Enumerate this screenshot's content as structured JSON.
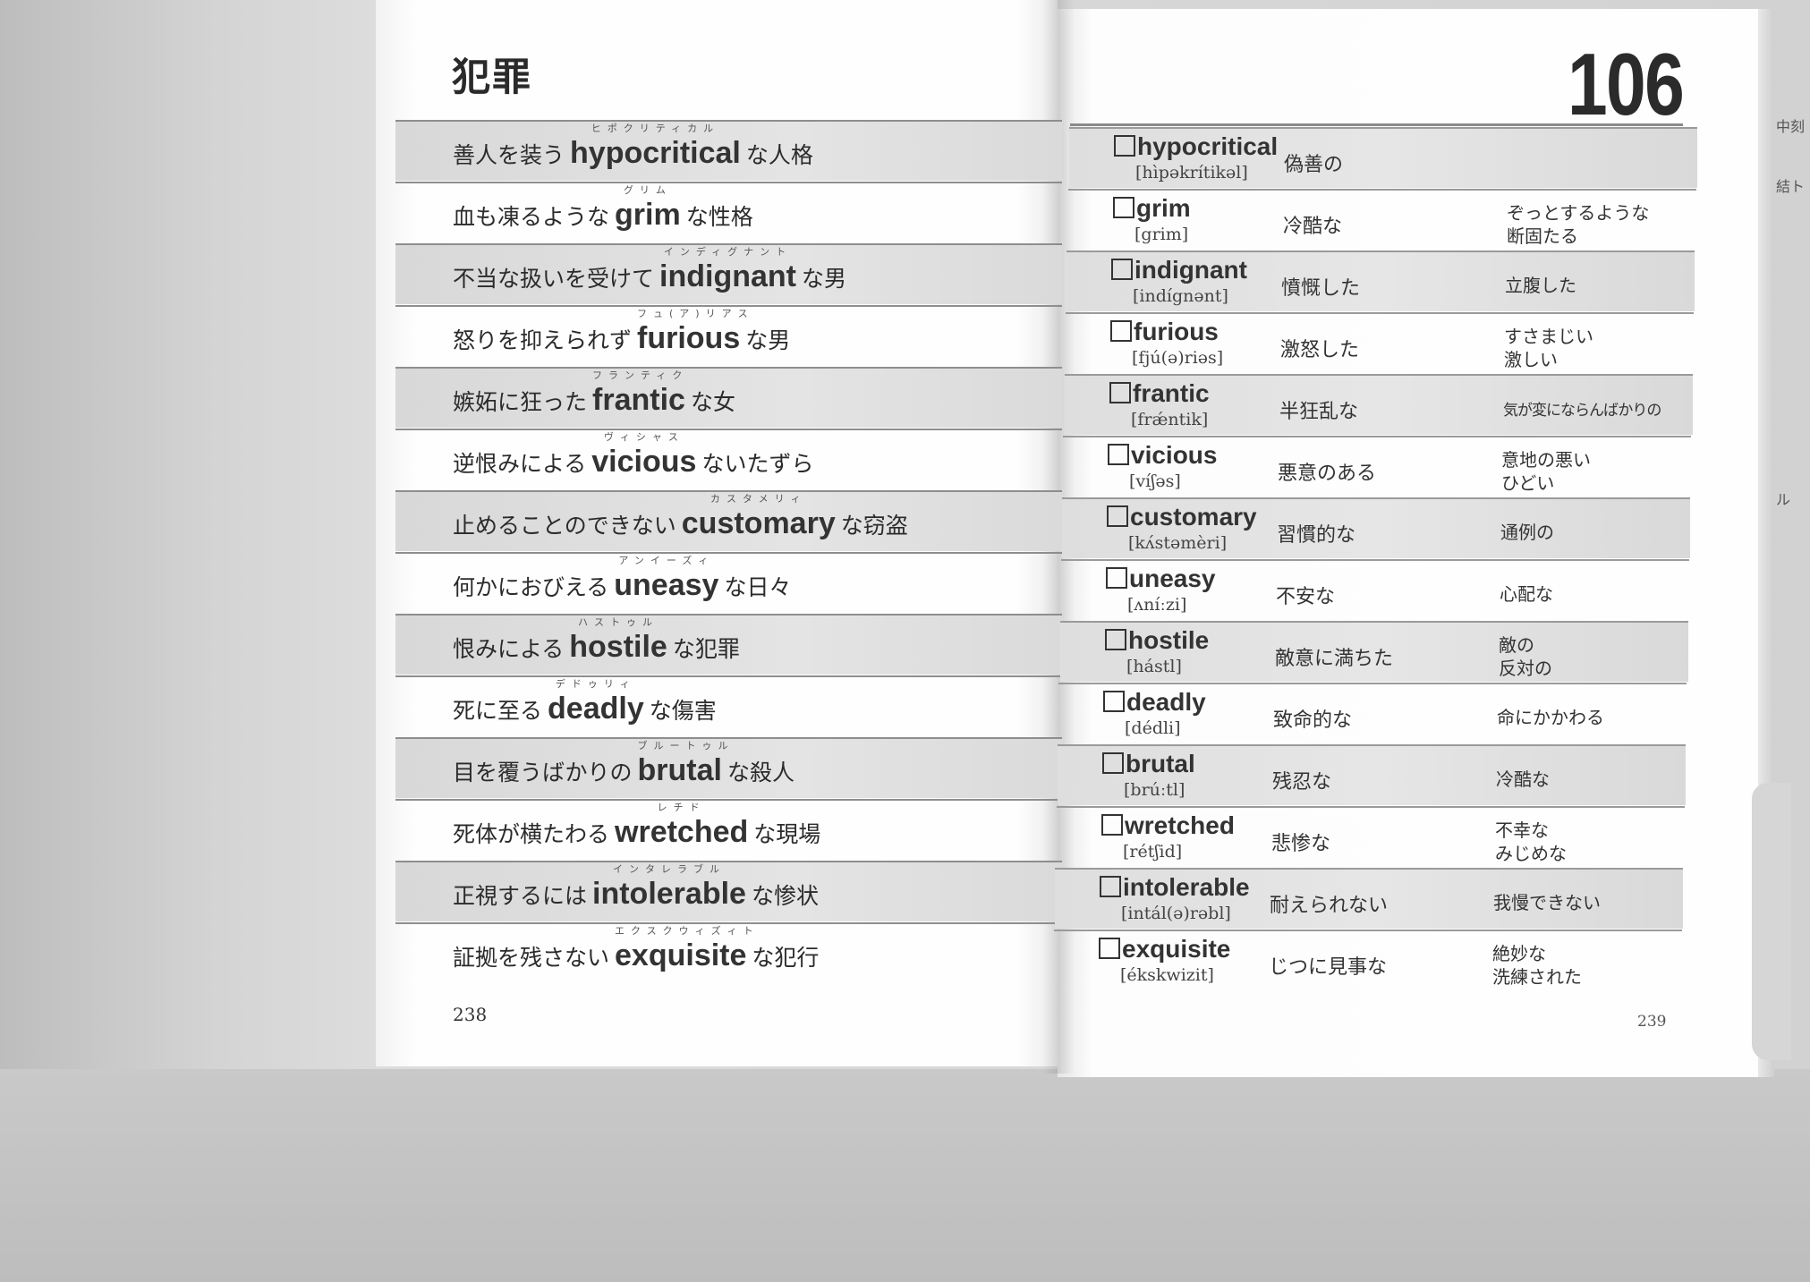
{
  "left_page": {
    "section_title": "犯罪",
    "page_number": "238",
    "phrases": [
      {
        "before": "善人を装う",
        "word": "hypocritical",
        "ruby": "ヒポクリティカル",
        "after": "な人格"
      },
      {
        "before": "血も凍るような",
        "word": "grim",
        "ruby": "グリム",
        "after": "な性格"
      },
      {
        "before": "不当な扱いを受けて",
        "word": "indignant",
        "ruby": "インディグナント",
        "after": "な男"
      },
      {
        "before": "怒りを抑えられず",
        "word": "furious",
        "ruby": "フュ(ア)リアス",
        "after": "な男"
      },
      {
        "before": "嫉妬に狂った",
        "word": "frantic",
        "ruby": "フランティク",
        "after": "な女"
      },
      {
        "before": "逆恨みによる",
        "word": "vicious",
        "ruby": "ヴィシャス",
        "after": "ないたずら"
      },
      {
        "before": "止めることのできない",
        "word": "customary",
        "ruby": "カスタメリィ",
        "after": "な窃盗"
      },
      {
        "before": "何かにおびえる",
        "word": "uneasy",
        "ruby": "アンイーズィ",
        "after": "な日々"
      },
      {
        "before": "恨みによる",
        "word": "hostile",
        "ruby": "ハストゥル",
        "after": "な犯罪"
      },
      {
        "before": "死に至る",
        "word": "deadly",
        "ruby": "デドゥリィ",
        "after": "な傷害"
      },
      {
        "before": "目を覆うばかりの",
        "word": "brutal",
        "ruby": "ブルートゥル",
        "after": "な殺人"
      },
      {
        "before": "死体が横たわる",
        "word": "wretched",
        "ruby": "レチド",
        "after": "な現場"
      },
      {
        "before": "正視するには",
        "word": "intolerable",
        "ruby": "インタレラブル",
        "after": "な惨状"
      },
      {
        "before": "証拠を残さない",
        "word": "exquisite",
        "ruby": "エクスクウィズィト",
        "after": "な犯行"
      }
    ]
  },
  "right_page": {
    "lesson_number": "106",
    "page_number": "239",
    "vocab": [
      {
        "word": "hypocritical",
        "ipa": "[hìpəkrítikəl]",
        "meaning1": "偽善の",
        "meaning2": ""
      },
      {
        "word": "grim",
        "ipa": "[grim]",
        "meaning1": "冷酷な",
        "meaning2": "ぞっとするような 断固たる"
      },
      {
        "word": "indignant",
        "ipa": "[indígnənt]",
        "meaning1": "憤慨した",
        "meaning2": "立腹した"
      },
      {
        "word": "furious",
        "ipa": "[fjú(ə)riəs]",
        "meaning1": "激怒した",
        "meaning2": "すさまじい 激しい"
      },
      {
        "word": "frantic",
        "ipa": "[frǽntik]",
        "meaning1": "半狂乱な",
        "meaning2": "気が変にならんばかりの"
      },
      {
        "word": "vicious",
        "ipa": "[víʃəs]",
        "meaning1": "悪意のある",
        "meaning2": "意地の悪い ひどい"
      },
      {
        "word": "customary",
        "ipa": "[kʌ́stəmèri]",
        "meaning1": "習慣的な",
        "meaning2": "通例の"
      },
      {
        "word": "uneasy",
        "ipa": "[ʌníːzi]",
        "meaning1": "不安な",
        "meaning2": "心配な"
      },
      {
        "word": "hostile",
        "ipa": "[hástl]",
        "meaning1": "敵意に満ちた",
        "meaning2": "敵の 反対の"
      },
      {
        "word": "deadly",
        "ipa": "[dédli]",
        "meaning1": "致命的な",
        "meaning2": "命にかかわる"
      },
      {
        "word": "brutal",
        "ipa": "[brúːtl]",
        "meaning1": "残忍な",
        "meaning2": "冷酷な"
      },
      {
        "word": "wretched",
        "ipa": "[rétʃid]",
        "meaning1": "悲惨な",
        "meaning2": "不幸な みじめな"
      },
      {
        "word": "intolerable",
        "ipa": "[intál(ə)rəbl]",
        "meaning1": "耐えられない",
        "meaning2": "我慢できない"
      },
      {
        "word": "exquisite",
        "ipa": "[ékskwizit]",
        "meaning1": "じつに見事な",
        "meaning2": "絶妙な 洗練された"
      }
    ]
  },
  "bleed_through": [
    "中刻",
    "結ト",
    "ル"
  ]
}
